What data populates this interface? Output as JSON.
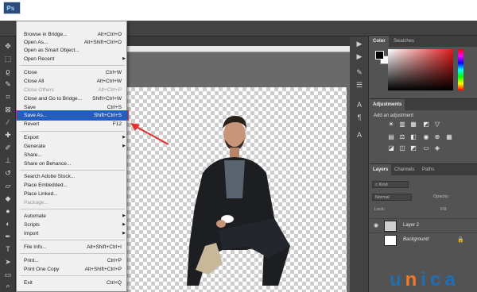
{
  "file_menu": {
    "items": [
      {
        "label": "Browse in Bridge...",
        "shortcut": "Alt+Ctrl+O"
      },
      {
        "label": "Open As...",
        "shortcut": "Alt+Shift+Ctrl+O"
      },
      {
        "label": "Open as Smart Object..."
      },
      {
        "label": "Open Recent",
        "submenu": true
      },
      {
        "label": "Close",
        "shortcut": "Ctrl+W"
      },
      {
        "label": "Close All",
        "shortcut": "Alt+Ctrl+W"
      },
      {
        "label": "Close Others",
        "shortcut": "Alt+Ctrl+P",
        "disabled": true
      },
      {
        "label": "Close and Go to Bridge...",
        "shortcut": "Shift+Ctrl+W"
      },
      {
        "label": "Save",
        "shortcut": "Ctrl+S"
      },
      {
        "label": "Save As...",
        "shortcut": "Shift+Ctrl+S",
        "highlighted": true
      },
      {
        "label": "Revert",
        "shortcut": "F12"
      },
      {
        "label": "Export",
        "submenu": true
      },
      {
        "label": "Generate",
        "submenu": true
      },
      {
        "label": "Share..."
      },
      {
        "label": "Share on Behance..."
      },
      {
        "label": "Search Adobe Stock..."
      },
      {
        "label": "Place Embedded..."
      },
      {
        "label": "Place Linked..."
      },
      {
        "label": "Package...",
        "disabled": true
      },
      {
        "label": "Automate",
        "submenu": true
      },
      {
        "label": "Scripts",
        "submenu": true
      },
      {
        "label": "Import",
        "submenu": true
      },
      {
        "label": "File Info...",
        "shortcut": "Alt+Shift+Ctrl+I"
      },
      {
        "label": "Print...",
        "shortcut": "Ctrl+P"
      },
      {
        "label": "Print One Copy",
        "shortcut": "Alt+Shift+Ctrl+P"
      },
      {
        "label": "Exit",
        "shortcut": "Ctrl+Q"
      }
    ]
  },
  "panels": {
    "color": {
      "tab_color": "Color",
      "tab_swatches": "Swatches"
    },
    "adjustments": {
      "tab": "Adjustments",
      "add_label": "Add an adjustment"
    },
    "layers": {
      "tab_layers": "Layers",
      "tab_channels": "Channels",
      "tab_paths": "Paths",
      "kind_filter": "Kind",
      "blend_mode": "Normal",
      "opacity_label": "Opacity:",
      "lock_label": "Lock:",
      "fill_label": "Fill:",
      "layers": [
        {
          "name": "Layer 2"
        },
        {
          "name": "Background"
        }
      ]
    }
  },
  "watermark": {
    "part1": "u",
    "part2": "n",
    "part3": "ica"
  },
  "colors": {
    "menu_highlight": "#1f5fbf",
    "annotation_red": "#e03030",
    "brand_blue": "#1e6fb3",
    "brand_orange": "#f27a24"
  }
}
